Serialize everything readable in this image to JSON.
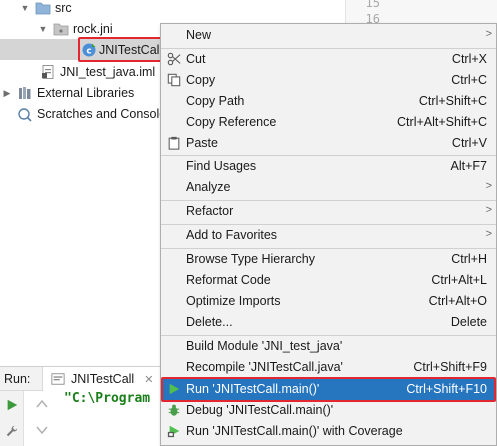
{
  "tree": {
    "items": [
      {
        "label": "src"
      },
      {
        "label": "rock.jni"
      },
      {
        "label": "JNITestCall"
      },
      {
        "label": "JNI_test_java.iml"
      },
      {
        "label": "External Libraries"
      },
      {
        "label": "Scratches and Consoles"
      }
    ]
  },
  "editor": {
    "line_numbers": [
      "15",
      "16"
    ]
  },
  "run": {
    "label": "Run:",
    "tab": "JNITestCall",
    "console_text": "\"C:\\Program"
  },
  "menu": {
    "items": [
      {
        "label": "New",
        "shortcut": ""
      },
      {
        "label": "Cut",
        "shortcut": "Ctrl+X"
      },
      {
        "label": "Copy",
        "shortcut": "Ctrl+C"
      },
      {
        "label": "Copy Path",
        "shortcut": "Ctrl+Shift+C"
      },
      {
        "label": "Copy Reference",
        "shortcut": "Ctrl+Alt+Shift+C"
      },
      {
        "label": "Paste",
        "shortcut": "Ctrl+V"
      },
      {
        "label": "Find Usages",
        "shortcut": "Alt+F7"
      },
      {
        "label": "Analyze",
        "shortcut": ""
      },
      {
        "label": "Refactor",
        "shortcut": ""
      },
      {
        "label": "Add to Favorites",
        "shortcut": ""
      },
      {
        "label": "Browse Type Hierarchy",
        "shortcut": "Ctrl+H"
      },
      {
        "label": "Reformat Code",
        "shortcut": "Ctrl+Alt+L"
      },
      {
        "label": "Optimize Imports",
        "shortcut": "Ctrl+Alt+O"
      },
      {
        "label": "Delete...",
        "shortcut": "Delete"
      },
      {
        "label": "Build Module 'JNI_test_java'",
        "shortcut": ""
      },
      {
        "label": "Recompile 'JNITestCall.java'",
        "shortcut": "Ctrl+Shift+F9"
      },
      {
        "label": "Run 'JNITestCall.main()'",
        "shortcut": "Ctrl+Shift+F10"
      },
      {
        "label": "Debug 'JNITestCall.main()'",
        "shortcut": ""
      },
      {
        "label": "Run 'JNITestCall.main()' with Coverage",
        "shortcut": ""
      }
    ]
  },
  "colors": {
    "highlight": "#2675bf",
    "annotation_red": "#e3262f",
    "run_green": "#3c9a3c",
    "console_green": "#1a7f1a"
  }
}
